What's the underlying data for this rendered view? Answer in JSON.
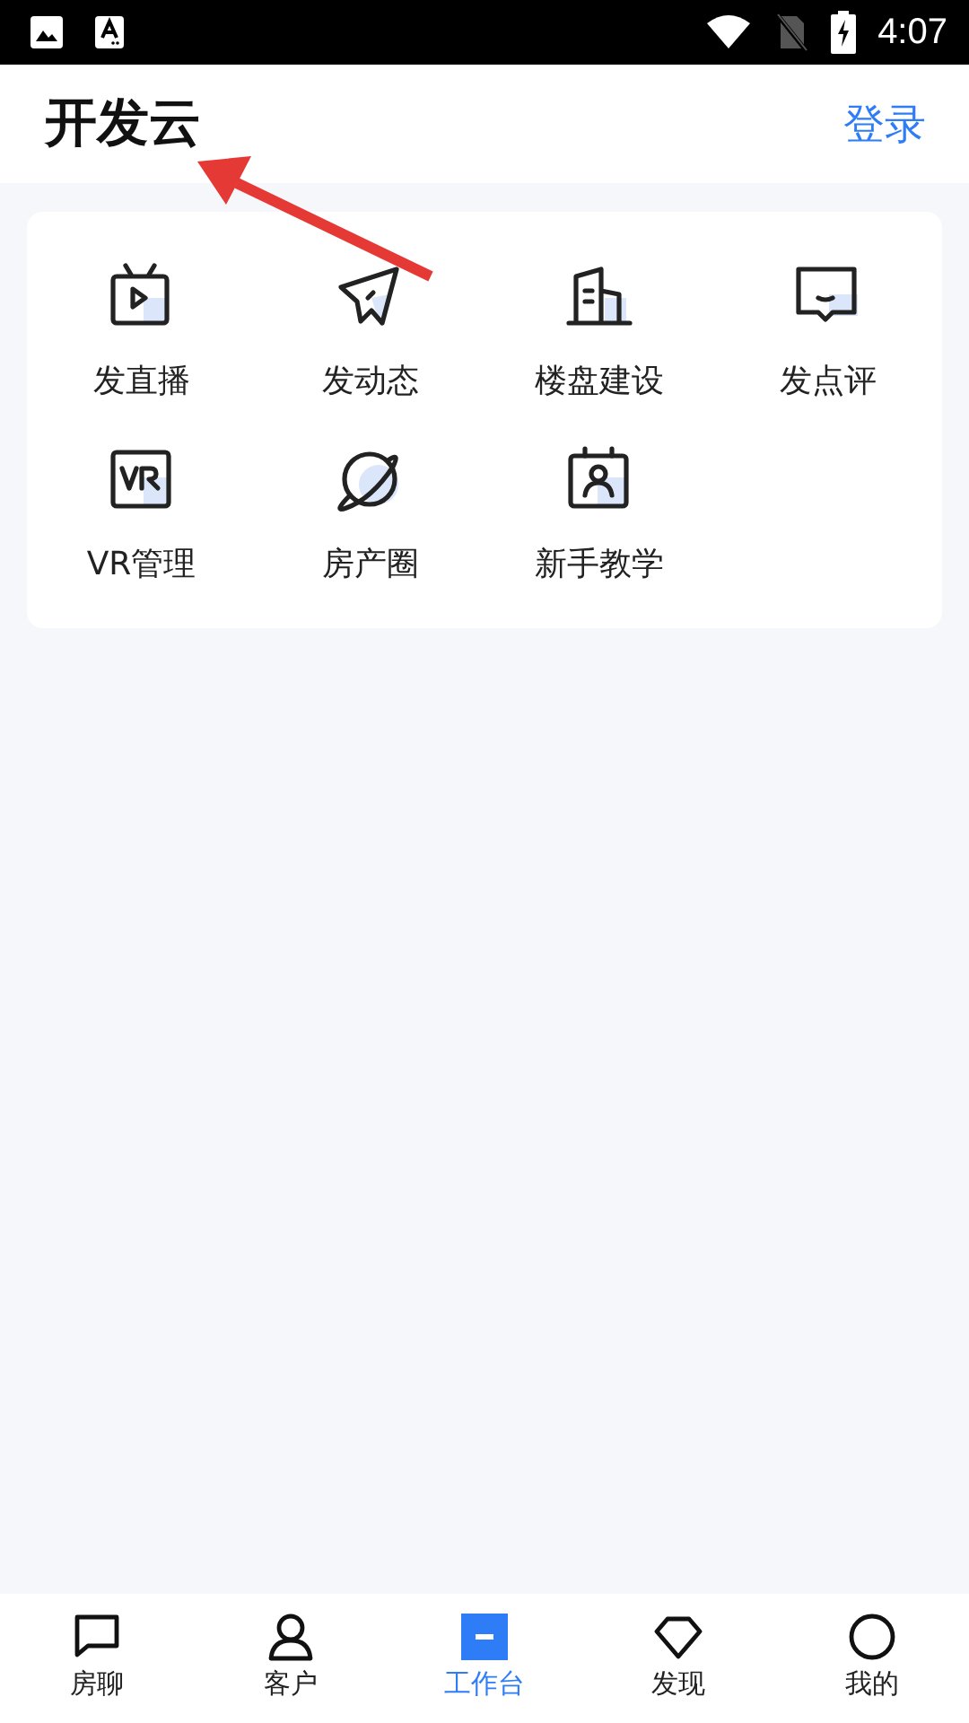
{
  "status_bar": {
    "time": "4:07"
  },
  "header": {
    "title": "开发云",
    "login": "登录"
  },
  "tools": [
    {
      "label": "发直播"
    },
    {
      "label": "发动态"
    },
    {
      "label": "楼盘建设"
    },
    {
      "label": "发点评"
    },
    {
      "label": "VR管理"
    },
    {
      "label": "房产圈"
    },
    {
      "label": "新手教学"
    }
  ],
  "annotation": {
    "kind": "arrow"
  },
  "bottom_nav": [
    {
      "label": "房聊",
      "selected": false
    },
    {
      "label": "客户",
      "selected": false
    },
    {
      "label": "工作台",
      "selected": true
    },
    {
      "label": "发现",
      "selected": false
    },
    {
      "label": "我的",
      "selected": false
    }
  ]
}
